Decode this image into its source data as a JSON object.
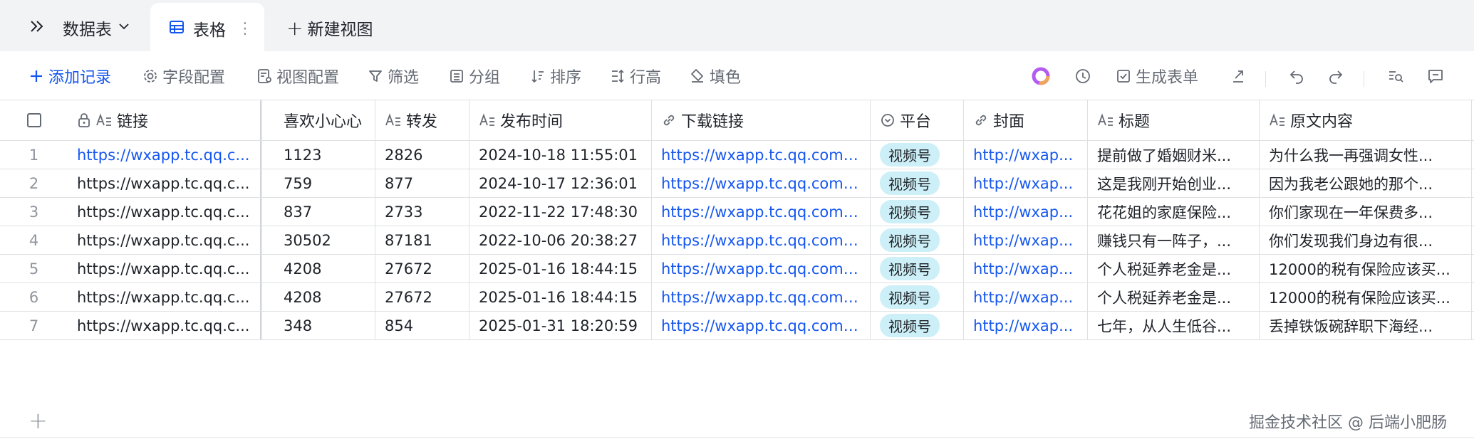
{
  "tabs": {
    "dropdown_label": "数据表",
    "active_label": "表格",
    "more_icon": "⋮",
    "new_view_label": "新建视图"
  },
  "toolbar": {
    "add_record": "添加记录",
    "field_config": "字段配置",
    "view_config": "视图配置",
    "filter": "筛选",
    "group": "分组",
    "sort": "排序",
    "row_height": "行高",
    "fill_color": "填色",
    "generate_form": "生成表单",
    "accent_color": "#1456f0"
  },
  "table": {
    "headers": {
      "link": "链接",
      "likes": "喜欢小心心",
      "shares": "转发",
      "publish_time": "发布时间",
      "download_link": "下载链接",
      "platform": "平台",
      "cover": "封面",
      "title": "标题",
      "content": "原文内容"
    },
    "rows": [
      {
        "no": "1",
        "link": "https://wxapp.tc.qq.c...",
        "likes": "1123",
        "shares": "2826",
        "time": "2024-10-18 11:55:01",
        "download": "https://wxapp.tc.qq.com/...",
        "platform": "视频号",
        "cover": "http://wxap...",
        "title": "提前做了婚姻财米...",
        "content": "为什么我一再强调女性..."
      },
      {
        "no": "2",
        "link": "https://wxapp.tc.qq.c...",
        "likes": "759",
        "shares": "877",
        "time": "2024-10-17 12:36:01",
        "download": "https://wxapp.tc.qq.com/...",
        "platform": "视频号",
        "cover": "http://wxap...",
        "title": "这是我刚开始创业...",
        "content": "因为我老公跟她的那个..."
      },
      {
        "no": "3",
        "link": "https://wxapp.tc.qq.c...",
        "likes": "837",
        "shares": "2733",
        "time": "2022-11-22 17:48:30",
        "download": "https://wxapp.tc.qq.com/...",
        "platform": "视频号",
        "cover": "http://wxap...",
        "title": "花花姐的家庭保险...",
        "content": "你们家现在一年保费多..."
      },
      {
        "no": "4",
        "link": "https://wxapp.tc.qq.c...",
        "likes": "30502",
        "shares": "87181",
        "time": "2022-10-06 20:38:27",
        "download": "https://wxapp.tc.qq.com/...",
        "platform": "视频号",
        "cover": "http://wxap...",
        "title": "赚钱只有一阵子，...",
        "content": "你们发现我们身边有很..."
      },
      {
        "no": "5",
        "link": "https://wxapp.tc.qq.c...",
        "likes": "4208",
        "shares": "27672",
        "time": "2025-01-16 18:44:15",
        "download": "https://wxapp.tc.qq.com/...",
        "platform": "视频号",
        "cover": "http://wxap...",
        "title": "个人税延养老金是...",
        "content": "12000的税有保险应该买..."
      },
      {
        "no": "6",
        "link": "https://wxapp.tc.qq.c...",
        "likes": "4208",
        "shares": "27672",
        "time": "2025-01-16 18:44:15",
        "download": "https://wxapp.tc.qq.com/...",
        "platform": "视频号",
        "cover": "http://wxap...",
        "title": "个人税延养老金是...",
        "content": "12000的税有保险应该买..."
      },
      {
        "no": "7",
        "link": "https://wxapp.tc.qq.c...",
        "likes": "348",
        "shares": "854",
        "time": "2025-01-31 18:20:59",
        "download": "https://wxapp.tc.qq.com/...",
        "platform": "视频号",
        "cover": "http://wxap...",
        "title": "七年，从人生低谷...",
        "content": "丢掉铁饭碗辞职下海经..."
      }
    ]
  },
  "footer": {
    "add_row_icon": "+",
    "watermark": "掘金技术社区 @ 后端小肥肠"
  }
}
